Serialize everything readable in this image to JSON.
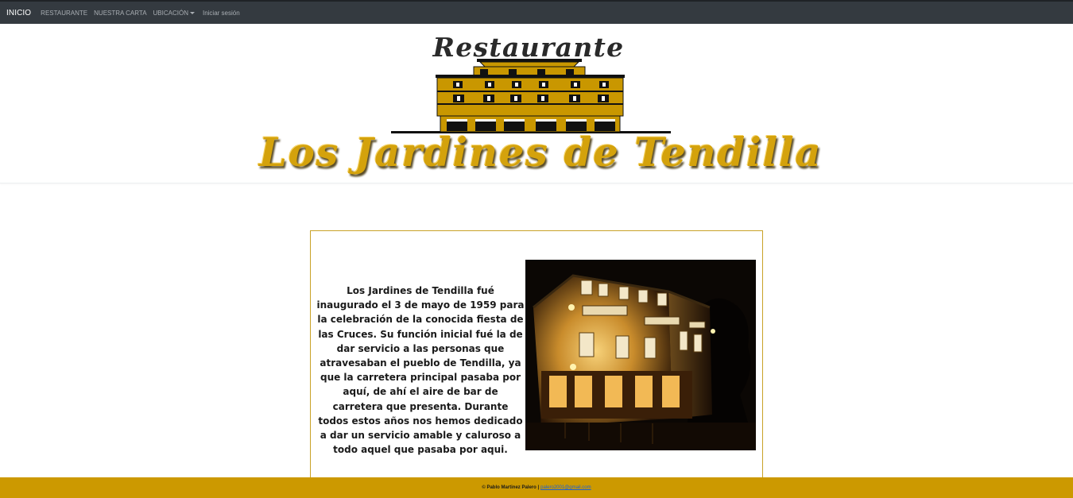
{
  "navbar": {
    "brand": "INICIO",
    "items": [
      {
        "label": "RESTAURANTE"
      },
      {
        "label": "NUESTRA CARTA"
      },
      {
        "label": "UBICACIÓN"
      }
    ],
    "login": "Iniciar sesión"
  },
  "logo": {
    "top_text": "Restaurante",
    "bottom_text": "Los Jardines de Tendilla"
  },
  "main": {
    "description": "Los Jardines de Tendilla fué inaugurado el 3 de mayo de 1959 para la celebración de la conocida fiesta de las Cruces. Su función inicial fué la de dar servicio a las personas que atravesaban el pueblo de Tendilla, ya que la carretera principal pasaba por aquí, de ahí el aire de bar de carretera que presenta. Durante todos estos años nos hemos dedicado a dar un servicio amable y caluroso a todo aquel que pasaba por aqui."
  },
  "footer": {
    "copyright": "© Pablo Martinez Palero |",
    "email": "palero2001@gmail.com"
  },
  "colors": {
    "navbar_bg": "#343a40",
    "accent_gold": "#cc9900",
    "logo_gold": "#d4a20c"
  }
}
